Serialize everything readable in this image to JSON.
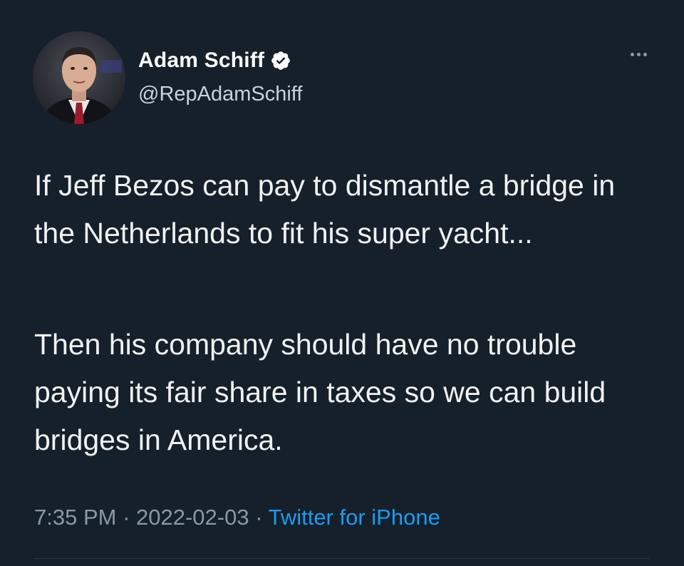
{
  "tweet": {
    "author": {
      "display_name": "Adam Schiff",
      "handle": "@RepAdamSchiff",
      "verified": true
    },
    "paragraphs": [
      "If Jeff Bezos can pay to dismantle a bridge in the Netherlands to fit his super yacht...",
      "Then his company should have no trouble paying its fair share in taxes so we can build bridges in America."
    ],
    "time": "7:35 PM",
    "separator": " · ",
    "date": "2022-02-03",
    "source": "Twitter for iPhone"
  },
  "colors": {
    "background": "#15202b",
    "accent": "#1d9bf0",
    "muted": "#8b98a5"
  },
  "icons": {
    "verified": "verified-badge-icon",
    "more": "more-horizontal-icon"
  }
}
